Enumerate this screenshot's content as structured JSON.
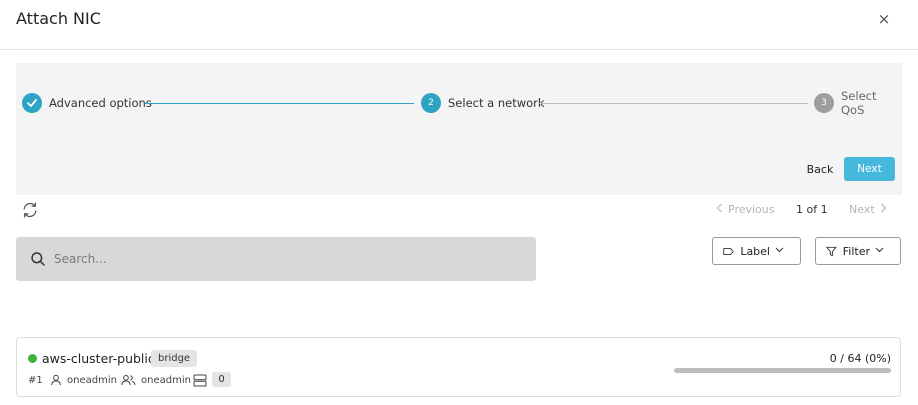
{
  "dialog": {
    "title": "Attach NIC",
    "close_glyph": "×"
  },
  "stepper": {
    "steps": [
      {
        "number": "1",
        "label": "Advanced options",
        "state": "done"
      },
      {
        "number": "2",
        "label": "Select a network",
        "state": "active"
      },
      {
        "number": "3",
        "label": "Select QoS",
        "state": "todo"
      }
    ],
    "back_label": "Back",
    "next_label": "Next"
  },
  "toolbar": {
    "refresh_icon": "refresh-icon",
    "pager_prev": "Previous",
    "pager_count": "1 of 1",
    "pager_next": "Next"
  },
  "search": {
    "placeholder": "Search..."
  },
  "filters": {
    "label_button": "Label",
    "filter_button": "Filter"
  },
  "network": {
    "name": "aws-cluster-public",
    "type": "bridge",
    "id": "#1",
    "owner": "oneadmin",
    "group": "oneadmin",
    "clusters": "0",
    "usage_text": "0 / 64 (0%)",
    "usage_fraction": 0,
    "status_color": "#3db33d"
  },
  "colors": {
    "accent": "#2ea3c4",
    "next_button": "#46b8dd"
  }
}
